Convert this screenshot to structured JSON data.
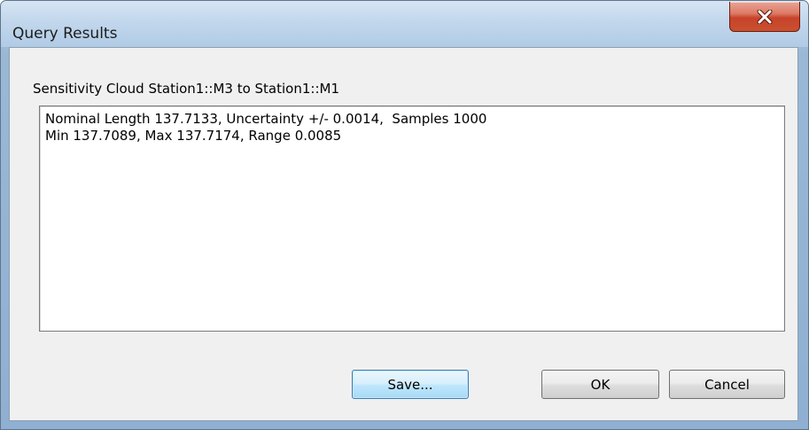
{
  "window": {
    "title": "Query Results"
  },
  "header": {
    "label": "Sensitivity Cloud Station1::M3 to Station1::M1"
  },
  "results": {
    "lines": [
      "Nominal Length 137.7133, Uncertainty +/- 0.0014,  Samples 1000",
      "Min 137.7089, Max 137.7174, Range 0.0085"
    ]
  },
  "buttons": {
    "save_label": "Save...",
    "ok_label": "OK",
    "cancel_label": "Cancel"
  },
  "icons": {
    "close": "close-icon"
  },
  "colors": {
    "close_button": "#c8432a",
    "default_button_border": "#3c7fb1",
    "dialog_background": "#f0f0f0"
  }
}
